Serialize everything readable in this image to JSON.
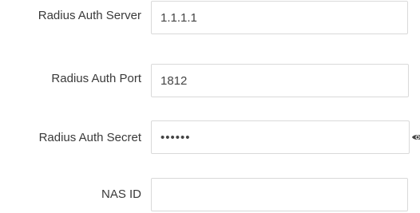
{
  "form": {
    "fields": [
      {
        "label": "Radius Auth Server",
        "value": "1.1.1.1",
        "placeholder": ""
      },
      {
        "label": "Radius Auth Port",
        "value": "1812",
        "placeholder": ""
      },
      {
        "label": "Radius Auth Secret",
        "value": "••••••",
        "placeholder": ""
      },
      {
        "label": "NAS ID",
        "value": "",
        "placeholder": ""
      }
    ]
  },
  "icons": {
    "show_password": "eye-icon"
  },
  "colors": {
    "input_border": "#d9d9d9",
    "label_text": "#3a3a3a",
    "input_text": "#444444",
    "background": "#ffffff"
  }
}
